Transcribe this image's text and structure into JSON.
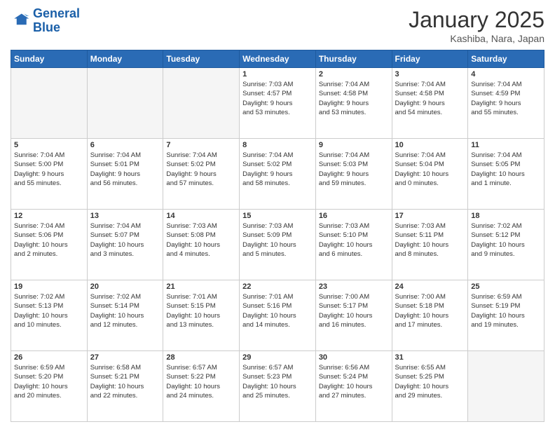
{
  "header": {
    "logo_line1": "General",
    "logo_line2": "Blue",
    "month": "January 2025",
    "location": "Kashiba, Nara, Japan"
  },
  "days_of_week": [
    "Sunday",
    "Monday",
    "Tuesday",
    "Wednesday",
    "Thursday",
    "Friday",
    "Saturday"
  ],
  "weeks": [
    [
      {
        "num": "",
        "info": ""
      },
      {
        "num": "",
        "info": ""
      },
      {
        "num": "",
        "info": ""
      },
      {
        "num": "1",
        "info": "Sunrise: 7:03 AM\nSunset: 4:57 PM\nDaylight: 9 hours\nand 53 minutes."
      },
      {
        "num": "2",
        "info": "Sunrise: 7:04 AM\nSunset: 4:58 PM\nDaylight: 9 hours\nand 53 minutes."
      },
      {
        "num": "3",
        "info": "Sunrise: 7:04 AM\nSunset: 4:58 PM\nDaylight: 9 hours\nand 54 minutes."
      },
      {
        "num": "4",
        "info": "Sunrise: 7:04 AM\nSunset: 4:59 PM\nDaylight: 9 hours\nand 55 minutes."
      }
    ],
    [
      {
        "num": "5",
        "info": "Sunrise: 7:04 AM\nSunset: 5:00 PM\nDaylight: 9 hours\nand 55 minutes."
      },
      {
        "num": "6",
        "info": "Sunrise: 7:04 AM\nSunset: 5:01 PM\nDaylight: 9 hours\nand 56 minutes."
      },
      {
        "num": "7",
        "info": "Sunrise: 7:04 AM\nSunset: 5:02 PM\nDaylight: 9 hours\nand 57 minutes."
      },
      {
        "num": "8",
        "info": "Sunrise: 7:04 AM\nSunset: 5:02 PM\nDaylight: 9 hours\nand 58 minutes."
      },
      {
        "num": "9",
        "info": "Sunrise: 7:04 AM\nSunset: 5:03 PM\nDaylight: 9 hours\nand 59 minutes."
      },
      {
        "num": "10",
        "info": "Sunrise: 7:04 AM\nSunset: 5:04 PM\nDaylight: 10 hours\nand 0 minutes."
      },
      {
        "num": "11",
        "info": "Sunrise: 7:04 AM\nSunset: 5:05 PM\nDaylight: 10 hours\nand 1 minute."
      }
    ],
    [
      {
        "num": "12",
        "info": "Sunrise: 7:04 AM\nSunset: 5:06 PM\nDaylight: 10 hours\nand 2 minutes."
      },
      {
        "num": "13",
        "info": "Sunrise: 7:04 AM\nSunset: 5:07 PM\nDaylight: 10 hours\nand 3 minutes."
      },
      {
        "num": "14",
        "info": "Sunrise: 7:03 AM\nSunset: 5:08 PM\nDaylight: 10 hours\nand 4 minutes."
      },
      {
        "num": "15",
        "info": "Sunrise: 7:03 AM\nSunset: 5:09 PM\nDaylight: 10 hours\nand 5 minutes."
      },
      {
        "num": "16",
        "info": "Sunrise: 7:03 AM\nSunset: 5:10 PM\nDaylight: 10 hours\nand 6 minutes."
      },
      {
        "num": "17",
        "info": "Sunrise: 7:03 AM\nSunset: 5:11 PM\nDaylight: 10 hours\nand 8 minutes."
      },
      {
        "num": "18",
        "info": "Sunrise: 7:02 AM\nSunset: 5:12 PM\nDaylight: 10 hours\nand 9 minutes."
      }
    ],
    [
      {
        "num": "19",
        "info": "Sunrise: 7:02 AM\nSunset: 5:13 PM\nDaylight: 10 hours\nand 10 minutes."
      },
      {
        "num": "20",
        "info": "Sunrise: 7:02 AM\nSunset: 5:14 PM\nDaylight: 10 hours\nand 12 minutes."
      },
      {
        "num": "21",
        "info": "Sunrise: 7:01 AM\nSunset: 5:15 PM\nDaylight: 10 hours\nand 13 minutes."
      },
      {
        "num": "22",
        "info": "Sunrise: 7:01 AM\nSunset: 5:16 PM\nDaylight: 10 hours\nand 14 minutes."
      },
      {
        "num": "23",
        "info": "Sunrise: 7:00 AM\nSunset: 5:17 PM\nDaylight: 10 hours\nand 16 minutes."
      },
      {
        "num": "24",
        "info": "Sunrise: 7:00 AM\nSunset: 5:18 PM\nDaylight: 10 hours\nand 17 minutes."
      },
      {
        "num": "25",
        "info": "Sunrise: 6:59 AM\nSunset: 5:19 PM\nDaylight: 10 hours\nand 19 minutes."
      }
    ],
    [
      {
        "num": "26",
        "info": "Sunrise: 6:59 AM\nSunset: 5:20 PM\nDaylight: 10 hours\nand 20 minutes."
      },
      {
        "num": "27",
        "info": "Sunrise: 6:58 AM\nSunset: 5:21 PM\nDaylight: 10 hours\nand 22 minutes."
      },
      {
        "num": "28",
        "info": "Sunrise: 6:57 AM\nSunset: 5:22 PM\nDaylight: 10 hours\nand 24 minutes."
      },
      {
        "num": "29",
        "info": "Sunrise: 6:57 AM\nSunset: 5:23 PM\nDaylight: 10 hours\nand 25 minutes."
      },
      {
        "num": "30",
        "info": "Sunrise: 6:56 AM\nSunset: 5:24 PM\nDaylight: 10 hours\nand 27 minutes."
      },
      {
        "num": "31",
        "info": "Sunrise: 6:55 AM\nSunset: 5:25 PM\nDaylight: 10 hours\nand 29 minutes."
      },
      {
        "num": "",
        "info": ""
      }
    ]
  ]
}
